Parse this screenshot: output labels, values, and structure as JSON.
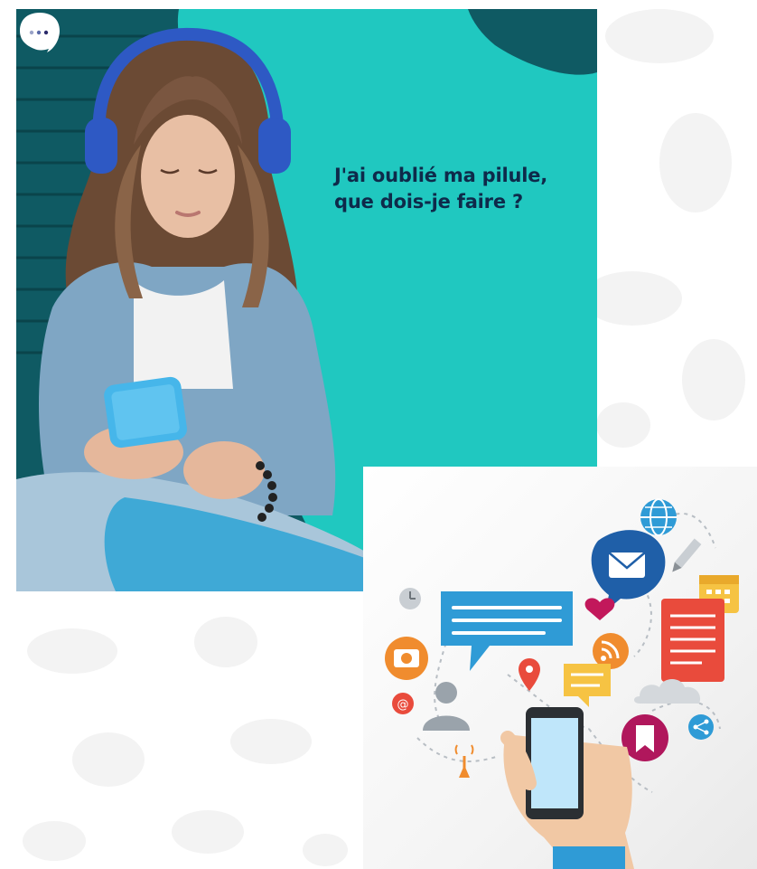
{
  "image": {
    "kind": "collage",
    "photo": {
      "headline_line1": "J'ai oublié ma pilule,",
      "headline_line2": "que dois-je faire ?",
      "bubble_icon": "chat-bubble-dots-icon",
      "colors": {
        "teal": "#20c8c0",
        "navy": "#0e2a4a",
        "headphones": "#2e59c4",
        "phone": "#46b6ea"
      }
    },
    "illustration": {
      "icons": [
        "globe-icon",
        "mail-icon",
        "pencil-icon",
        "calendar-icon",
        "clock-icon",
        "heart-icon",
        "document-icon",
        "camera-icon",
        "rss-icon",
        "location-pin-icon",
        "at-sign-icon",
        "user-icon",
        "cloud-icon",
        "share-icon",
        "bookmark-icon",
        "antenna-icon",
        "smartphone-icon",
        "hand-icon",
        "chat-bubble-icon"
      ],
      "colors": {
        "blue": "#2f9bd6",
        "orange": "#f08c2e",
        "red": "#e94b3c",
        "yellow": "#f6c343",
        "magenta": "#c2185b",
        "gray": "#9aa3ab"
      }
    }
  }
}
